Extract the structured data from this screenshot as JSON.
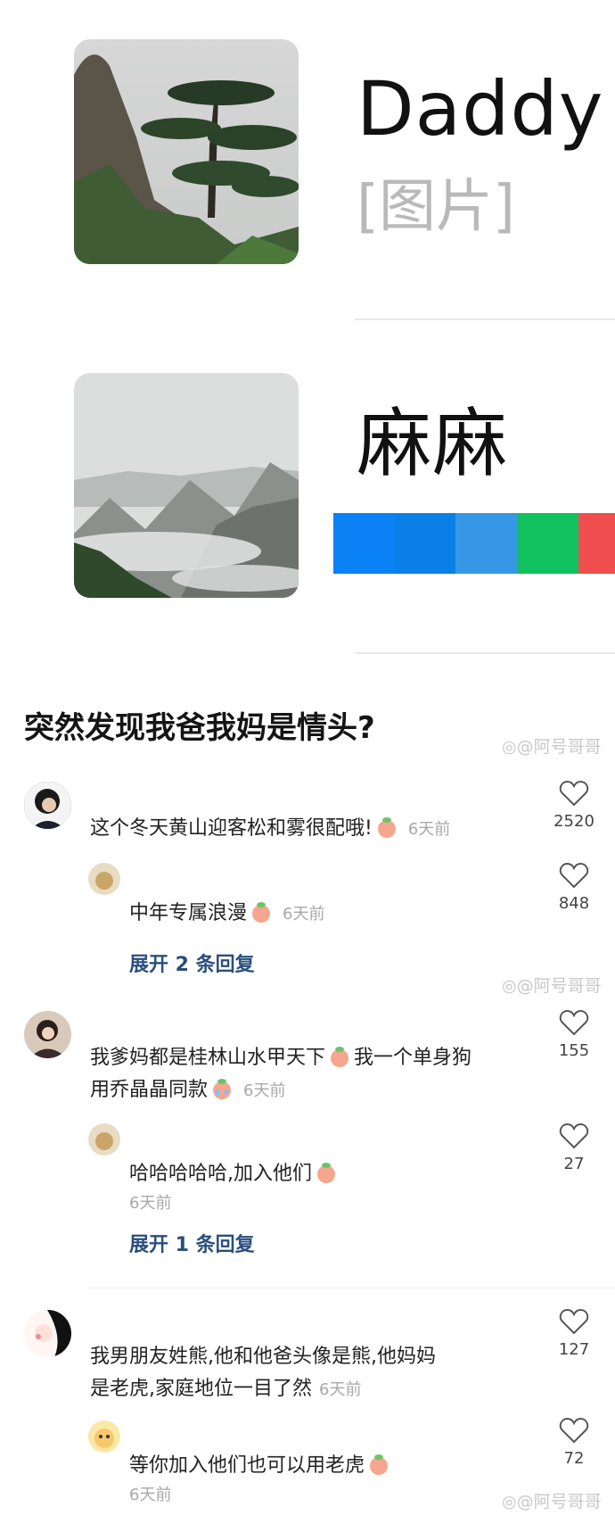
{
  "contacts": [
    {
      "name": "Daddy",
      "preview": "[图片]"
    },
    {
      "name": "麻麻"
    }
  ],
  "color_bar": [
    "#0a82f5",
    "#0a80e6",
    "#3697e6",
    "#10c25f",
    "#f04e4e"
  ],
  "post_title": "突然发现我爸我妈是情头?",
  "watermark": "@阿号哥哥",
  "comments": [
    {
      "text": "这个冬天黄山迎客松和雾很配哦!",
      "time": "6天前",
      "likes": "2520"
    },
    {
      "text": "中年专属浪漫",
      "time": "6天前",
      "likes": "848"
    },
    {
      "expand": "展开 2 条回复"
    },
    {
      "text_line1": "我爹妈都是桂林山水甲天下",
      "text_line1b": "我一个单身狗",
      "text_line2": "用乔晶晶同款",
      "time": "6天前",
      "likes": "155"
    },
    {
      "text": "哈哈哈哈哈,加入他们",
      "time": "6天前",
      "likes": "27"
    },
    {
      "expand": "展开 1 条回复"
    },
    {
      "text_line1": "我男朋友姓熊,他和他爸头像是熊,他妈妈",
      "text_line2": "是老虎,家庭地位一目了然",
      "time": "6天前",
      "likes": "127"
    },
    {
      "text": "等你加入他们也可以用老虎",
      "time": "6天前",
      "likes": "72"
    }
  ]
}
